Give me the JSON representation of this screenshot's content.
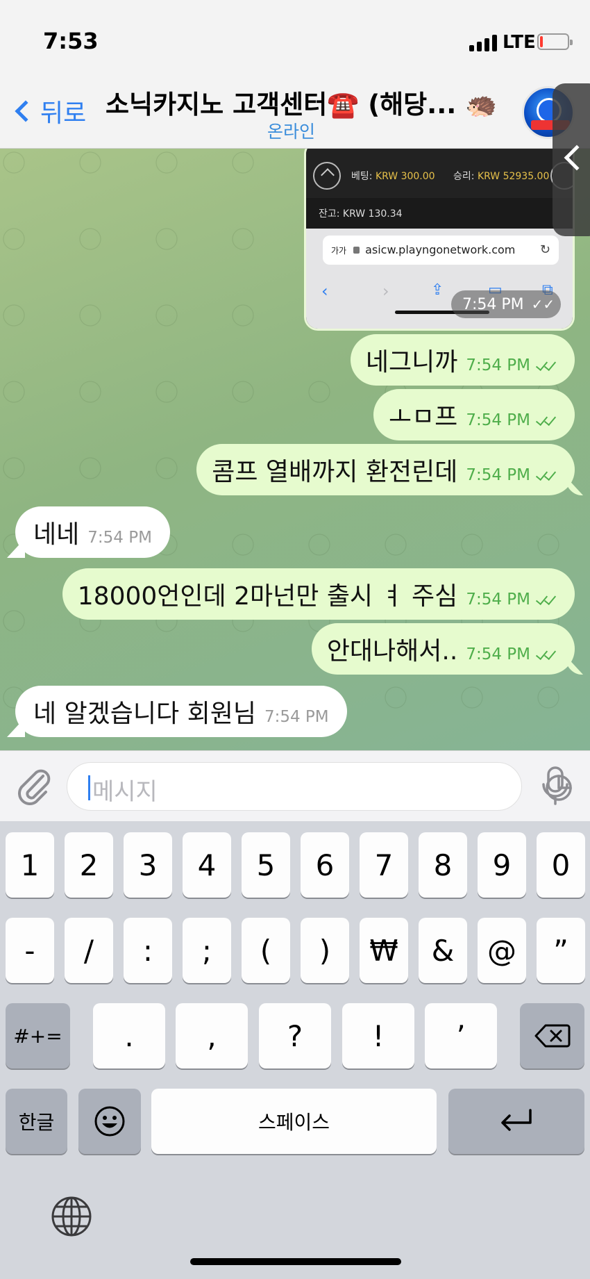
{
  "status_bar": {
    "time": "7:53",
    "network": "LTE",
    "battery_level": 0.1
  },
  "header": {
    "back_label": "뒤로",
    "title": "소닉카지노 고객센터☎️ (해당... 🦔",
    "status": "온라인"
  },
  "image_message": {
    "bet_label": "베팅:",
    "bet_value": "KRW 300.00",
    "win_label": "승리:",
    "win_value": "KRW 52935.00",
    "balance": "잔고: KRW 130.34",
    "url_aa": "가가",
    "url": "asicw.playngonetwork.com",
    "time": "7:54 PM"
  },
  "messages": [
    {
      "direction": "out",
      "text": "네그니까",
      "time": "7:54 PM",
      "read": true
    },
    {
      "direction": "out",
      "text": "ㅗㅁ프",
      "time": "7:54 PM",
      "read": true
    },
    {
      "direction": "out",
      "text": "콤프 열배까지 환전린데",
      "time": "7:54 PM",
      "read": true
    },
    {
      "direction": "in",
      "text": "네네",
      "time": "7:54 PM"
    },
    {
      "direction": "out",
      "text": "18000언인데 2마넌만 출시 ㅕ 주심",
      "time": "7:54 PM",
      "read": true
    },
    {
      "direction": "out",
      "text": "안대나해서..",
      "time": "7:54 PM",
      "read": true
    },
    {
      "direction": "in",
      "text": "네 알겠습니다 회원님",
      "time": "7:54 PM"
    }
  ],
  "input": {
    "placeholder": "메시지"
  },
  "keyboard": {
    "row1": [
      "1",
      "2",
      "3",
      "4",
      "5",
      "6",
      "7",
      "8",
      "9",
      "0"
    ],
    "row2": [
      "-",
      "/",
      ":",
      ";",
      "(",
      ")",
      "₩",
      "&",
      "@",
      "”"
    ],
    "row3": [
      ".",
      ",",
      "?",
      "!",
      "’"
    ],
    "symbols_key": "#+=",
    "lang_key": "한글",
    "space_key": "스페이스"
  }
}
